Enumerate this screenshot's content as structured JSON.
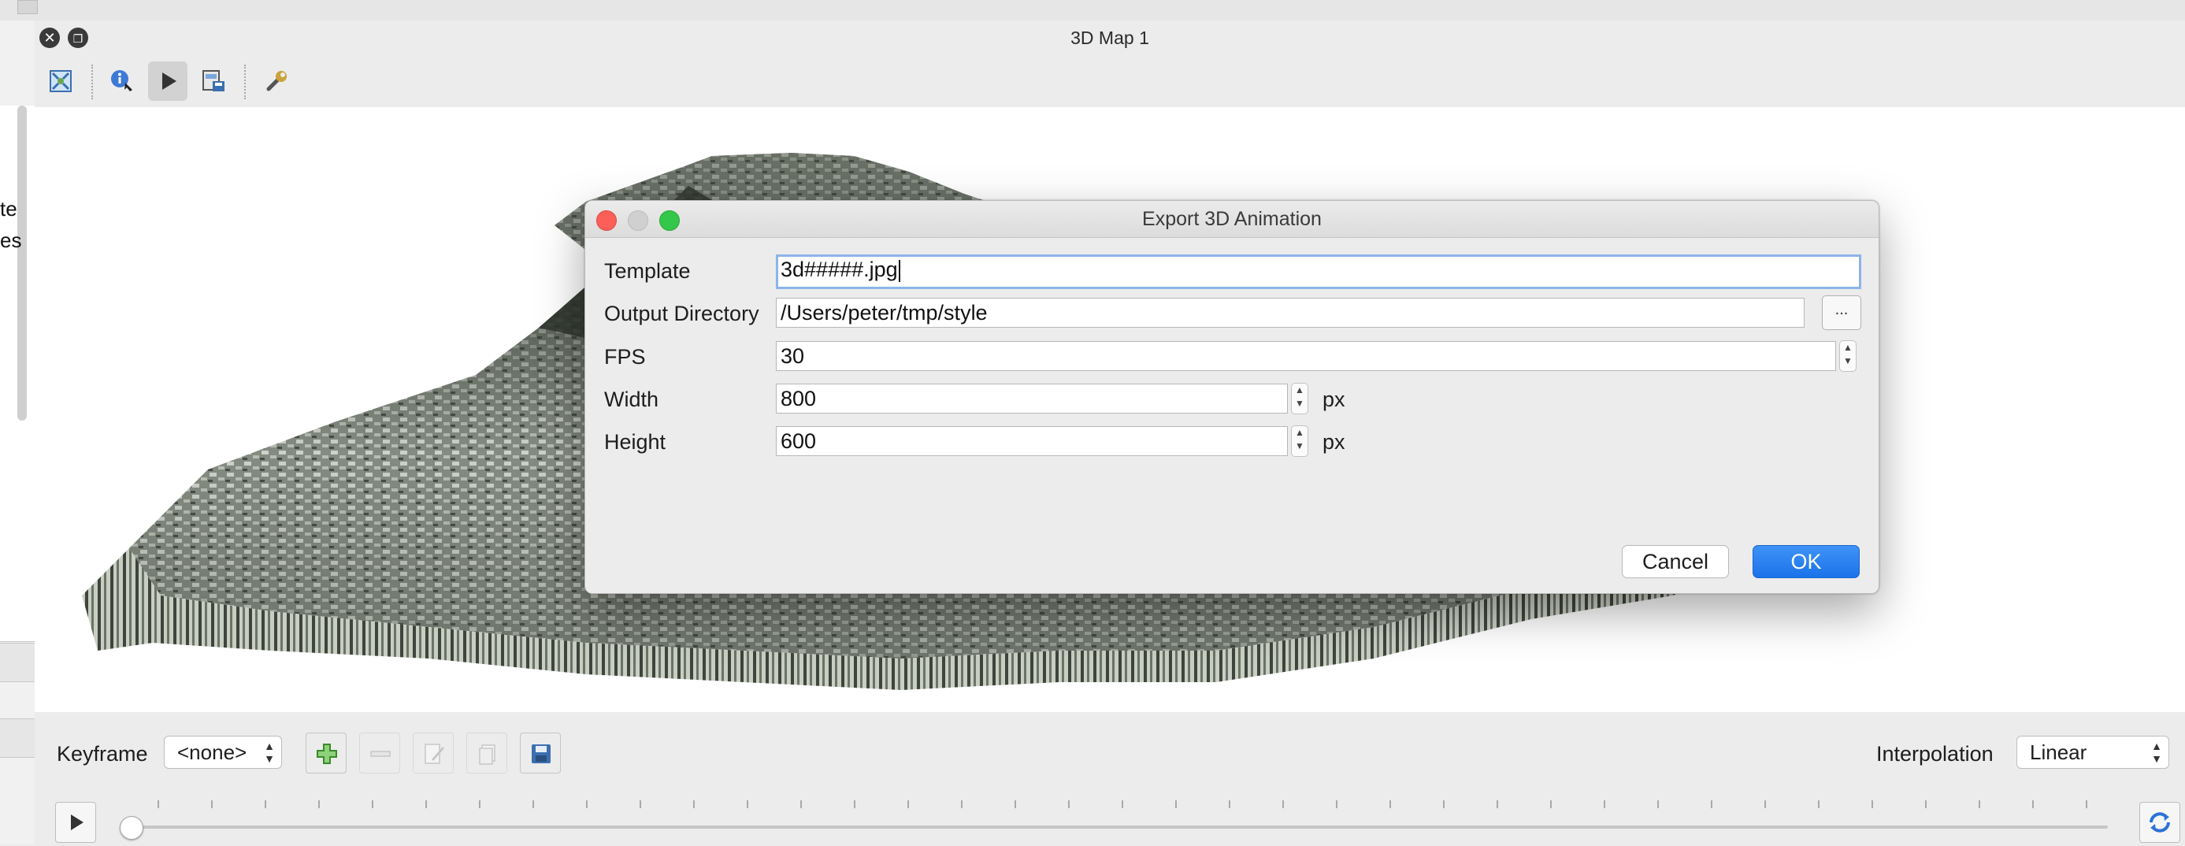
{
  "window": {
    "title": "3D Map 1"
  },
  "left_panel": {
    "text_fragments": [
      "te",
      "es"
    ]
  },
  "toolbar": {
    "tools": [
      "zoom-full-icon",
      "identify-icon",
      "play-animation-icon",
      "save-image-icon",
      "configure-icon"
    ],
    "active_tool": "play-animation-icon"
  },
  "dialog": {
    "title": "Export 3D Animation",
    "template_label": "Template",
    "template_value": "3d#####.jpg",
    "output_dir_label": "Output Directory",
    "output_dir_value": "/Users/peter/tmp/style",
    "browse_label": "...",
    "fps_label": "FPS",
    "fps_value": "30",
    "width_label": "Width",
    "width_value": "800",
    "height_label": "Height",
    "height_value": "600",
    "unit": "px",
    "cancel_label": "Cancel",
    "ok_label": "OK",
    "colors": {
      "close": "#fc5f57",
      "minimize": "#d0d0d0",
      "zoom": "#34c749",
      "ok": "#1f77ec",
      "focus_ring": "#8cb4ea"
    }
  },
  "keyframes": {
    "label": "Keyframe",
    "selected": "<none>",
    "interpolation_label": "Interpolation",
    "interpolation_value": "Linear",
    "buttons": [
      "add-keyframe-icon",
      "remove-keyframe-icon",
      "edit-keyframe-icon",
      "duplicate-keyframe-icon",
      "save-keyframe-icon"
    ]
  },
  "timeline": {
    "position": 0
  }
}
